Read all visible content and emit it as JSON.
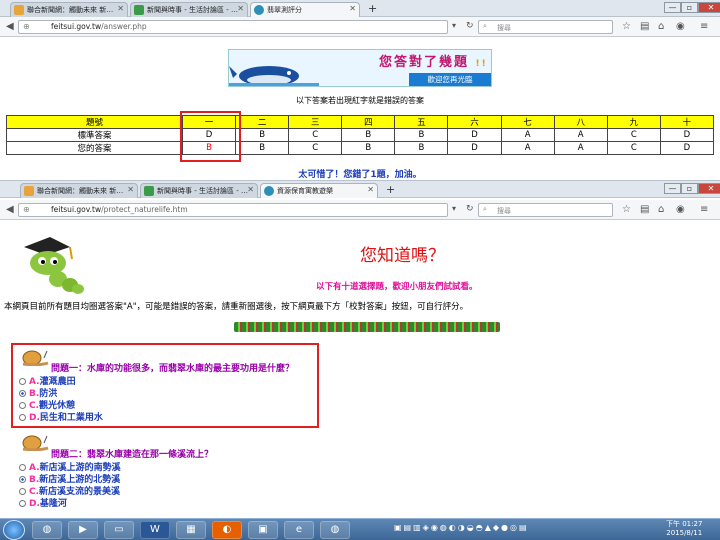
{
  "back_window": {
    "tabs": [
      {
        "label": "聯合新聞網：觸動未來 新…",
        "active": false
      },
      {
        "label": "新聞與時事 - 生活討論區 - …",
        "active": false
      },
      {
        "label": "翡翠測評分",
        "active": true
      }
    ],
    "url": {
      "domain": "feitsui.gov.tw",
      "path": "/answer.php"
    },
    "search_placeholder": "搜尋",
    "banner": {
      "main": "您答對了幾題",
      "suffix": "!!",
      "sub": "歡迎您再光臨"
    },
    "answer_title": "以下答案若出現紅字就是錯誤的答案",
    "table": {
      "headers": [
        "題號",
        "一",
        "二",
        "三",
        "四",
        "五",
        "六",
        "七",
        "八",
        "九",
        "十"
      ],
      "rows": [
        {
          "label": "標準答案",
          "cells": [
            "D",
            "B",
            "C",
            "B",
            "B",
            "D",
            "A",
            "A",
            "C",
            "D"
          ]
        },
        {
          "label": "您的答案",
          "cells": [
            "B",
            "B",
            "C",
            "B",
            "B",
            "D",
            "A",
            "A",
            "C",
            "D"
          ]
        }
      ],
      "wrong_index": 0
    },
    "result": "太可惜了！您錯了1題，加油。"
  },
  "front_window": {
    "tabs": [
      {
        "label": "聯合新聞網：觸動未來 新…",
        "active": false
      },
      {
        "label": "新聞與時事 - 生活討論區 - …",
        "active": false
      },
      {
        "label": "資源保育寓教遊樂",
        "active": true
      }
    ],
    "url": {
      "domain": "feitsui.gov.tw",
      "path": "/protect_naturelife.htm"
    },
    "search_placeholder": "搜尋",
    "heading": "您知道嗎？",
    "subheading": "以下有十道選擇題，歡迎小朋友們試試看。",
    "instructions": "本網頁目前所有題目均圈選答案\"A\"，可能是錯誤的答案，請重新圈選後，按下網頁最下方「校對答案」按鈕，可自行評分。",
    "questions": [
      {
        "title": "問題一：水庫的功能很多，而翡翠水庫的最主要功用是什麼？",
        "options": [
          {
            "letter": "A.",
            "text": "灌溉農田"
          },
          {
            "letter": "B.",
            "text": "防洪"
          },
          {
            "letter": "C.",
            "text": "觀光休憩"
          },
          {
            "letter": "D.",
            "text": "民生和工業用水"
          }
        ],
        "selected": 1
      },
      {
        "title": "問題二：翡翠水庫建造在那一條溪流上？",
        "options": [
          {
            "letter": "A.",
            "text": "新店溪上游的南勢溪"
          },
          {
            "letter": "B.",
            "text": "新店溪上游的北勢溪"
          },
          {
            "letter": "C.",
            "text": "新店溪支流的景美溪"
          },
          {
            "letter": "D.",
            "text": "基隆河"
          }
        ],
        "selected": 1
      }
    ]
  },
  "taskbar": {
    "time": "下午 01:27",
    "date": "2015/8/11"
  },
  "colors": {
    "highlight": "#e02020",
    "question": "#9900aa",
    "option": "#1e3fb8",
    "letter": "#ff2a9c",
    "header_yellow": "#ffff00"
  }
}
